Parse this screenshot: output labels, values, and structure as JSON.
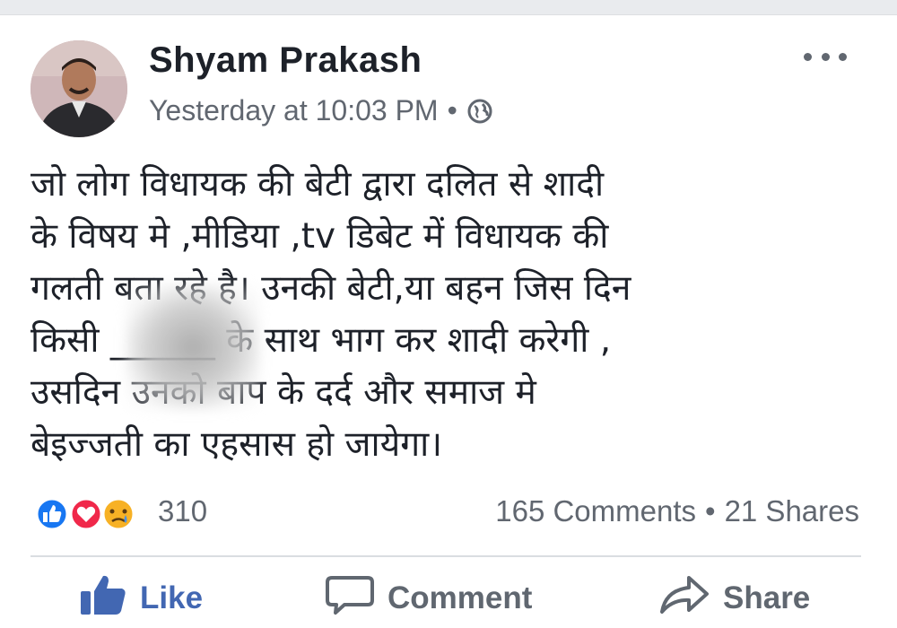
{
  "post": {
    "author": "Shyam Prakash",
    "timestamp": "Yesterday at 10:03 PM",
    "separator": "•",
    "privacy_icon": "globe-icon",
    "text_lines": [
      "जो लोग विधायक की बेटी  द्वारा दलित से शादी",
      "के विषय मे ,मीडिया ,tv डिबेट में विधायक की",
      "गलती बता रहे है। उनकी बेटी,या बहन जिस दिन",
      "किसी ______ के साथ भाग कर शादी करेगी  ,",
      "उसदिन उनको बाप के दर्द और समाज मे",
      "बेइज्जती का एहसास हो जायेगा।"
    ]
  },
  "stats": {
    "reaction_icons": [
      "like-reaction-icon",
      "love-reaction-icon",
      "sad-reaction-icon"
    ],
    "reaction_count": "310",
    "comments": "165 Comments",
    "separator": "•",
    "shares": "21 Shares"
  },
  "actions": {
    "like": "Like",
    "comment": "Comment",
    "share": "Share"
  },
  "colors": {
    "facebook_blue": "#4267b2",
    "love_red": "#f0284a",
    "sad_yellow": "#f7b125",
    "text_primary": "#1d2129",
    "text_secondary": "#616770"
  }
}
